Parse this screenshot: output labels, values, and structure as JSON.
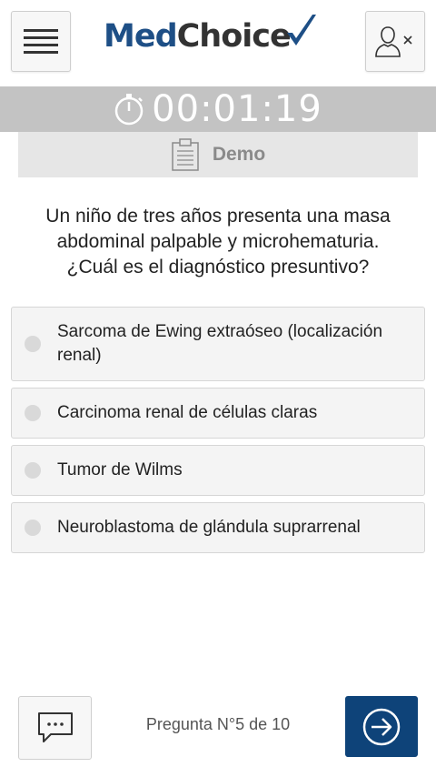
{
  "header": {
    "logo_part1": "Med",
    "logo_part2": "Choice",
    "menu_icon": "hamburger-menu-icon",
    "user_icon": "user-close-icon"
  },
  "timer": {
    "icon": "stopwatch-icon",
    "value": "00:01:19"
  },
  "mode": {
    "icon": "clipboard-icon",
    "label": "Demo"
  },
  "question": {
    "text": "Un niño de tres años presenta una masa abdominal palpable y microhematuria. ¿Cuál es el diagnóstico presuntivo?"
  },
  "options": [
    {
      "label": "Sarcoma de Ewing extraóseo (localización renal)"
    },
    {
      "label": "Carcinoma renal de células claras"
    },
    {
      "label": "Tumor de Wilms"
    },
    {
      "label": "Neuroblastoma de glándula suprarrenal"
    }
  ],
  "footer": {
    "chat_icon": "chat-bubble-icon",
    "counter": "Pregunta N°5 de 10",
    "next_icon": "arrow-right-circle-icon"
  },
  "colors": {
    "brand_blue": "#1e4f86",
    "next_button": "#0e4379",
    "timer_bar": "#c3c3c3",
    "demo_bar": "#e6e6e6"
  }
}
